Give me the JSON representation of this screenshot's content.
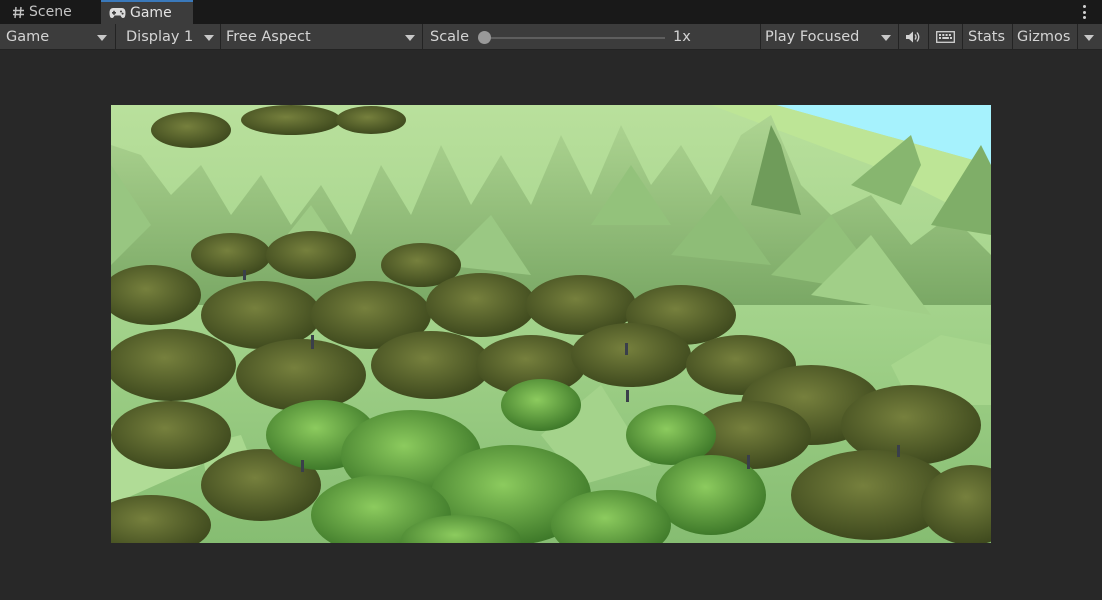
{
  "tabs": {
    "scene_label": "Scene",
    "game_label": "Game",
    "active": "Game"
  },
  "toolbar": {
    "view_mode": "Game",
    "display": "Display 1",
    "aspect": "Free Aspect",
    "scale_label": "Scale",
    "scale_value": "1x",
    "play_mode": "Play Focused",
    "stats_label": "Stats",
    "gizmos_label": "Gizmos"
  },
  "icons": {
    "scene_tab": "hash-icon",
    "game_tab": "gamepad-icon",
    "audio": "speaker-icon",
    "keyboard": "keyboard-icon",
    "more": "kebab-menu-icon"
  },
  "colors": {
    "tab_accent": "#3a79bb",
    "toolbar_bg": "#3c3c3c",
    "viewport_bg": "#282828",
    "sky": "#a6f2fd",
    "terrain": "#9fcf84"
  }
}
